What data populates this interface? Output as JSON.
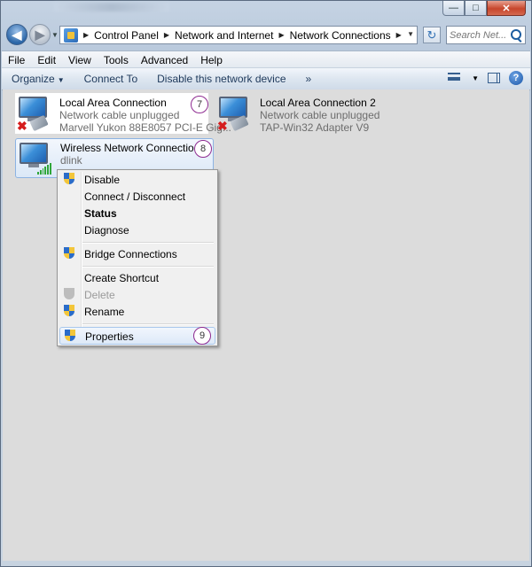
{
  "address": {
    "breadcrumbs": [
      "Control Panel",
      "Network and Internet",
      "Network Connections"
    ]
  },
  "search": {
    "placeholder": "Search Net..."
  },
  "menubar": {
    "items": [
      "File",
      "Edit",
      "View",
      "Tools",
      "Advanced",
      "Help"
    ]
  },
  "toolbar": {
    "organize": "Organize",
    "connect_to": "Connect To",
    "disable": "Disable this network device",
    "more": "»"
  },
  "connections": [
    {
      "name": "Local Area Connection",
      "status": "Network cable unplugged",
      "device": "Marvell Yukon 88E8057 PCI-E Gig...",
      "badge": "7"
    },
    {
      "name": "Local Area Connection 2",
      "status": "Network cable unplugged",
      "device": "TAP-Win32 Adapter V9"
    },
    {
      "name": "Wireless Network Connection",
      "status": "dlink",
      "badge": "8"
    }
  ],
  "context_menu": {
    "items": [
      "Disable",
      "Connect / Disconnect",
      "Status",
      "Diagnose",
      "Bridge Connections",
      "Create Shortcut",
      "Delete",
      "Rename",
      "Properties"
    ],
    "properties_badge": "9"
  }
}
